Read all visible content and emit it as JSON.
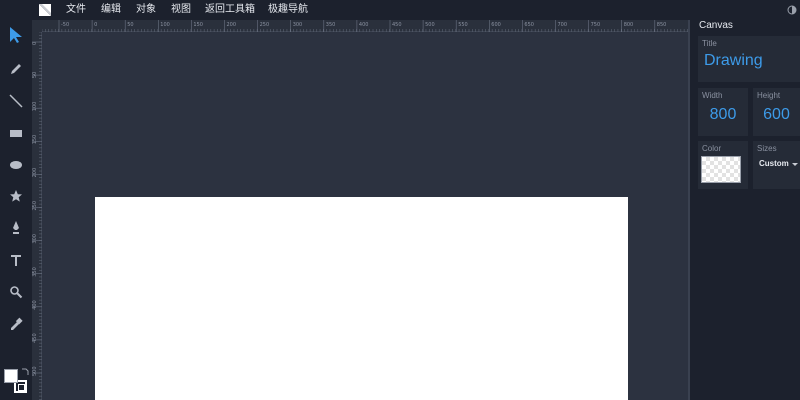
{
  "menu": {
    "items": [
      "文件",
      "编辑",
      "对象",
      "视图",
      "返回工具箱",
      "极趣导航"
    ]
  },
  "toolbar": {
    "tools": [
      "select-icon",
      "pencil-icon",
      "line-icon",
      "rectangle-icon",
      "ellipse-icon",
      "star-icon",
      "pen-icon",
      "text-icon",
      "zoom-icon",
      "eyedropper-icon"
    ],
    "fill_color": "#ffffff",
    "stroke_color": "#ffffff"
  },
  "rulers": {
    "top_labels": [
      "-50",
      "0",
      "50",
      "100",
      "150",
      "200",
      "250",
      "300",
      "350",
      "400",
      "450",
      "500",
      "550",
      "600",
      "650",
      "700",
      "750",
      "800",
      "850",
      "900",
      "950"
    ],
    "left_labels": [
      "0",
      "50",
      "100",
      "150",
      "200",
      "250",
      "300",
      "350",
      "400",
      "450",
      "500",
      "550"
    ]
  },
  "panel": {
    "title": "Canvas",
    "title_label": "Title",
    "title_value": "Drawing",
    "width_label": "Width",
    "width_value": "800",
    "height_label": "Height",
    "height_value": "600",
    "color_label": "Color",
    "sizes_label": "Sizes",
    "sizes_value": "Custom"
  },
  "colors": {
    "accent": "#3d9be9",
    "chrome": "#1c212d",
    "workspace": "#2c3240",
    "canvas": "#ffffff"
  }
}
